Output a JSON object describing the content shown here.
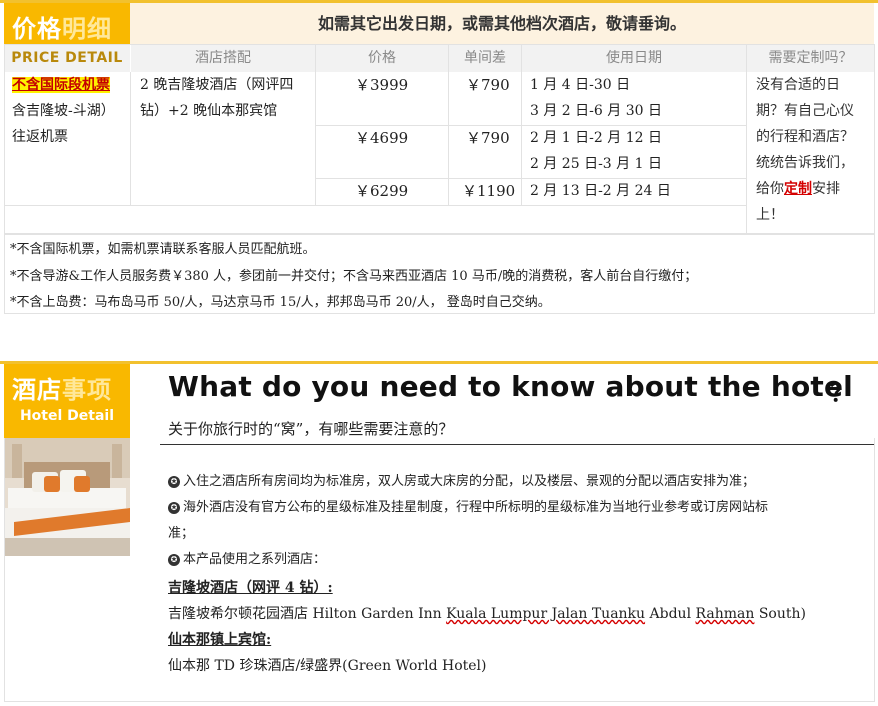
{
  "price_section": {
    "badge_title_a": "价格",
    "badge_title_b": "明细",
    "badge_sub": "PRICE DETAIL",
    "notice": "如需其它出发日期，或需其他档次酒店，敬请垂询。",
    "headers": [
      "酒店搭配",
      "价格",
      "单间差",
      "使用日期",
      "需要定制吗？"
    ],
    "ticket_tag": "不含国际段机票",
    "ticket_line2": "含吉隆坡-斗湖）",
    "ticket_line3": "往返机票",
    "hotel_combo_line1": "2 晚吉隆坡酒店（网评四",
    "hotel_combo_line2": "钻）+2 晚仙本那宾馆",
    "rows": [
      {
        "price": "￥3999",
        "single": "￥790",
        "dates": [
          "1 月 4 日-30 日",
          "3 月 2 日-6 月 30 日"
        ]
      },
      {
        "price": "￥4699",
        "single": "￥790",
        "dates": [
          "2 月 1 日-2 月 12 日",
          "2 月 25 日-3 月 1 日"
        ]
      },
      {
        "price": "￥6299",
        "single": "￥1190",
        "dates": [
          "2 月 13 日-2 月 24 日"
        ]
      }
    ],
    "custom_note_1": "没有合适的日",
    "custom_note_2": "期？有自己心仪",
    "custom_note_3": "的行程和酒店？",
    "custom_note_4": "统统告诉我们，",
    "custom_note_5a": "给你",
    "custom_note_5b": "定制",
    "custom_note_5c": "安排",
    "custom_note_6": "上！",
    "notes": [
      "*不含国际机票，如需机票请联系客服人员匹配航班。",
      "*不含导游&工作人员服务费￥380 人，参团前一并交付；不含马来西亚酒店 10 马币/晚的消费税，客人前台自行缴付；",
      "*不含上岛费：马布岛马币 50/人，马达京马币 15/人，邦邦岛马币 20/人，  登岛时自己交纳。"
    ]
  },
  "hotel_section": {
    "badge_title_a": "酒店",
    "badge_title_b": "事项",
    "badge_sub": "Hotel Detail",
    "title": "What do you need to know about the hotel",
    "title_q": "？",
    "subtitle": "关于你旅行时的“窝”，有哪些需要注意的？",
    "bullets": [
      "入住之酒店所有房间均为标准房，双人房或大床房的分配，以及楼层、景观的分配以酒店安排为准；",
      "海外酒店没有官方公布的星级标准及挂星制度，行程中所标明的星级标准为当地行业参考或订房网站标",
      "本产品使用之系列酒店："
    ],
    "bullet2_cont": "准；",
    "kl_heading": "吉隆坡酒店（网评 4 钻）:",
    "kl_hotel_a": "吉隆坡希尔顿花园酒店 Hilton Garden Inn ",
    "kl_hotel_b": "Kuala Lumpur Jalan Tuanku",
    "kl_hotel_c": " Abdul ",
    "kl_hotel_d": "Rahman",
    "kl_hotel_e": " South)",
    "semporna_heading": "仙本那镇上宾馆:",
    "semporna_hotel": "仙本那 TD 珍珠酒店/绿盛界(Green World Hotel)"
  },
  "colors": {
    "accent": "#f9b800",
    "notice_bg": "#fdf2e0",
    "header_bg": "#f2f2f2",
    "alert": "#d40000"
  }
}
